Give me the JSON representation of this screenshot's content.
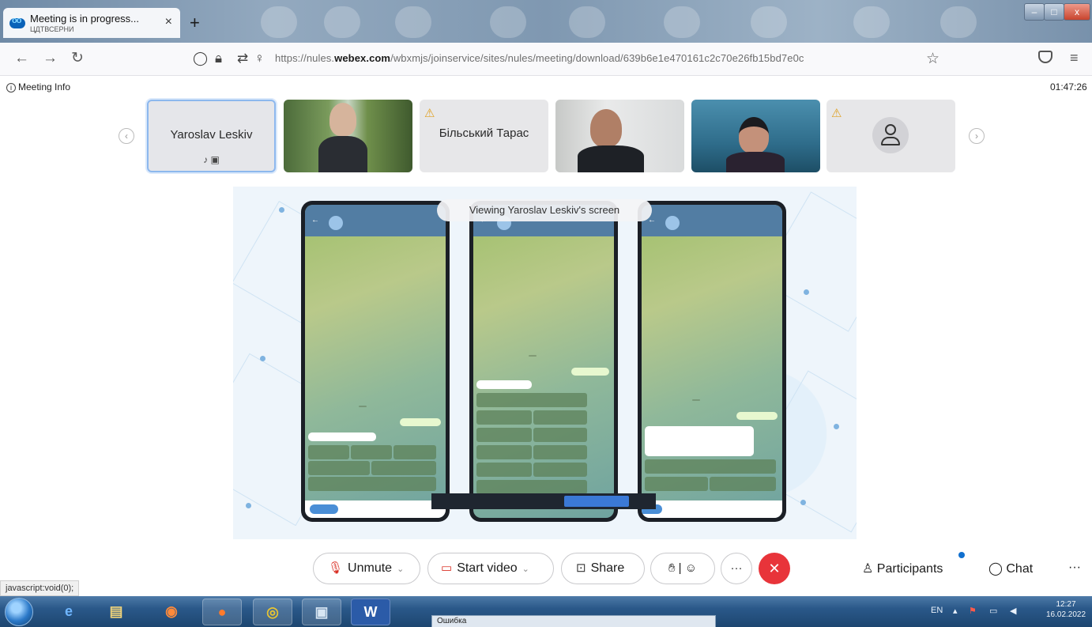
{
  "browser": {
    "tab": {
      "title": "Meeting is in progress...",
      "subtitle": "ЦДТВСЕРНИ"
    },
    "url_prefix": "https://nules.",
    "url_host": "webex.com",
    "url_path": "/wbxmjs/joinservice/sites/nules/meeting/download/639b6e1e470161c2c70e26fb15bd7e0c"
  },
  "meeting": {
    "info_label": "Meeting Info",
    "timer": "01:47:26"
  },
  "participants": [
    {
      "name": "Yaroslav Leskiv",
      "type": "tile",
      "selected": true
    },
    {
      "name": "",
      "type": "video"
    },
    {
      "name": "Більський Тарас",
      "type": "tile",
      "warning": true
    },
    {
      "name": "",
      "type": "video"
    },
    {
      "name": "",
      "type": "video"
    },
    {
      "name": "",
      "type": "avatar",
      "warning": true
    }
  ],
  "share": {
    "viewing_label": "Viewing Yaroslav Leskiv's screen"
  },
  "controls": {
    "unmute": "Unmute",
    "start_video": "Start video",
    "share": "Share",
    "participants": "Participants",
    "chat": "Chat"
  },
  "status_url": "javascript:void(0);",
  "taskbar": {
    "popup_title": "Ошибка",
    "lang": "EN",
    "time": "12:27",
    "date": "16.02.2022"
  },
  "colors": {
    "end_call": "#e8343a",
    "accent": "#1170cf",
    "selected_border": "#8db8ee"
  }
}
